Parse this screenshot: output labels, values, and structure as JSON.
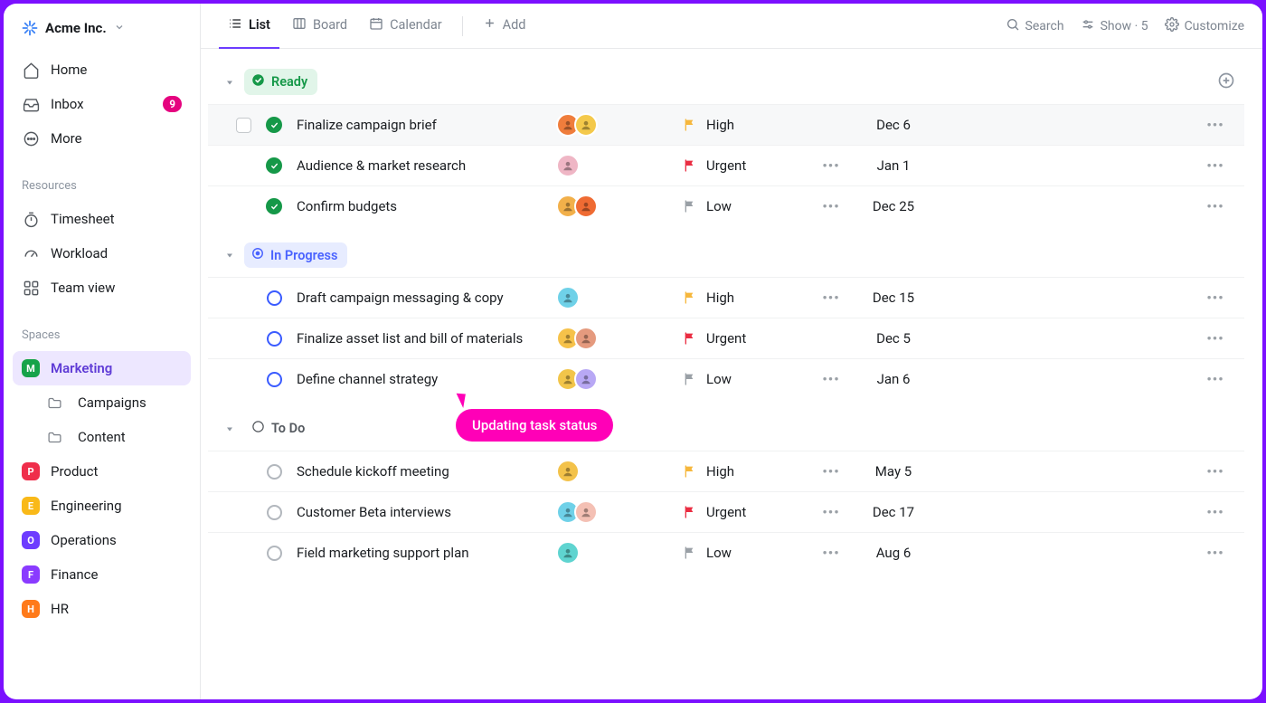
{
  "workspace": {
    "name": "Acme Inc."
  },
  "sidebar": {
    "home": {
      "label": "Home"
    },
    "inbox": {
      "label": "Inbox",
      "badge": "9"
    },
    "more": {
      "label": "More"
    },
    "sections": {
      "resources": {
        "label": "Resources",
        "timesheet": "Timesheet",
        "workload": "Workload",
        "teamview": "Team view"
      },
      "spaces": {
        "label": "Spaces",
        "marketing": {
          "label": "Marketing",
          "letter": "M",
          "color": "#16a34a"
        },
        "marketing_folders": {
          "campaigns": "Campaigns",
          "content": "Content"
        },
        "product": {
          "label": "Product",
          "letter": "P",
          "color": "#ef2e4b"
        },
        "engineering": {
          "label": "Engineering",
          "letter": "E",
          "color": "#f9b919"
        },
        "operations": {
          "label": "Operations",
          "letter": "O",
          "color": "#6d3cff"
        },
        "finance": {
          "label": "Finance",
          "letter": "F",
          "color": "#8a3bff"
        },
        "hr": {
          "label": "HR",
          "letter": "H",
          "color": "#ff7a1a"
        }
      }
    }
  },
  "topbar": {
    "views": {
      "list": "List",
      "board": "Board",
      "calendar": "Calendar",
      "add": "Add"
    },
    "right": {
      "search": "Search",
      "show": "Show · 5",
      "customize": "Customize"
    }
  },
  "groups": {
    "ready": {
      "label": "Ready",
      "tasks": [
        {
          "title": "Finalize campaign brief",
          "priority": "High",
          "date": "Dec 6",
          "avatars": [
            "#ef7d3c",
            "#f4c94b"
          ],
          "more1": false
        },
        {
          "title": "Audience & market research",
          "priority": "Urgent",
          "date": "Jan 1",
          "avatars": [
            "#efb6c5"
          ],
          "more1": true
        },
        {
          "title": "Confirm budgets",
          "priority": "Low",
          "date": "Dec 25",
          "avatars": [
            "#f2b04a",
            "#ef6b33"
          ],
          "more1": true
        }
      ]
    },
    "inprogress": {
      "label": "In Progress",
      "tasks": [
        {
          "title": "Draft campaign messaging & copy",
          "priority": "High",
          "date": "Dec 15",
          "avatars": [
            "#6fd1e8"
          ],
          "more1": true
        },
        {
          "title": "Finalize asset list and bill of materials",
          "priority": "Urgent",
          "date": "Dec 5",
          "avatars": [
            "#f6c24a",
            "#e59a7e"
          ],
          "more1": false
        },
        {
          "title": "Define channel strategy",
          "priority": "Low",
          "date": "Jan 6",
          "avatars": [
            "#f2c54a",
            "#b8a8f5"
          ],
          "more1": true
        }
      ]
    },
    "todo": {
      "label": "To Do",
      "tasks": [
        {
          "title": "Schedule kickoff meeting",
          "priority": "High",
          "date": "May 5",
          "avatars": [
            "#f3c24a"
          ],
          "more1": true
        },
        {
          "title": "Customer Beta interviews",
          "priority": "Urgent",
          "date": "Dec 17",
          "avatars": [
            "#6fd1e8",
            "#f4c0b4"
          ],
          "more1": true
        },
        {
          "title": "Field marketing support plan",
          "priority": "Low",
          "date": "Aug 6",
          "avatars": [
            "#5fd4d0"
          ],
          "more1": true
        }
      ]
    }
  },
  "cursor": {
    "label": "Updating task status"
  },
  "priority_colors": {
    "High": "#f6b73c",
    "Urgent": "#ea2d42",
    "Low": "#9aa0a6"
  },
  "dots": "•••"
}
